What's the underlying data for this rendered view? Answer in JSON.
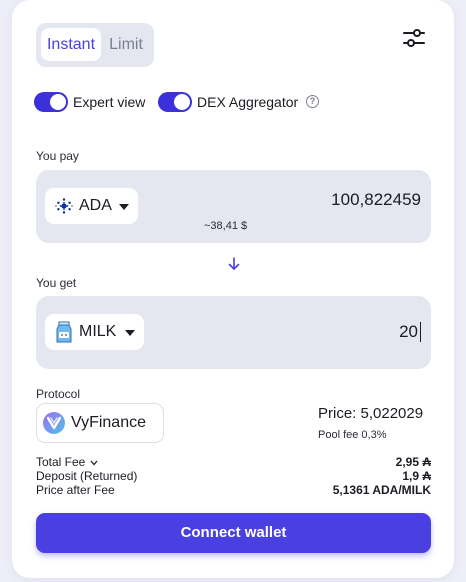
{
  "mode_tabs": {
    "instant": "Instant",
    "limit": "Limit",
    "active": "Instant"
  },
  "icons": {
    "settings": "sliders-icon",
    "info": "info-icon",
    "ada_logo": "cardano-logo-icon",
    "milk_logo": "milk-carton-icon",
    "arrow": "arrow-down-icon",
    "vyfinance_logo": "vyfinance-logo-icon"
  },
  "toggles": {
    "expert_view": {
      "label": "Expert view",
      "on": true
    },
    "dex_aggregator": {
      "label": "DEX Aggregator",
      "on": true
    }
  },
  "info_glyph": "?",
  "you_pay": {
    "label": "You pay",
    "token": "ADA",
    "amount": "100,822459",
    "usd_value": "~38,41 $"
  },
  "you_get": {
    "label": "You get",
    "token": "MILK",
    "amount": "20"
  },
  "protocol": {
    "label": "Protocol",
    "name": "VyFinance",
    "price": "Price: 5,022029",
    "pool_fee": "Pool fee 0,3%"
  },
  "fees": {
    "total_fee_label": "Total Fee",
    "total_fee_value": "2,95 ₳",
    "deposit_label": "Deposit (Returned)",
    "deposit_value": "1,9 ₳",
    "price_after_fee_label": "Price after Fee",
    "price_after_fee_value": "5,1361 ADA/MILK"
  },
  "connect_button": "Connect wallet",
  "colors": {
    "accent": "#4a3fe0",
    "toggle_on": "#3b30d9",
    "field_bg": "#e4e6f0",
    "ada_blue": "#0033ad"
  }
}
